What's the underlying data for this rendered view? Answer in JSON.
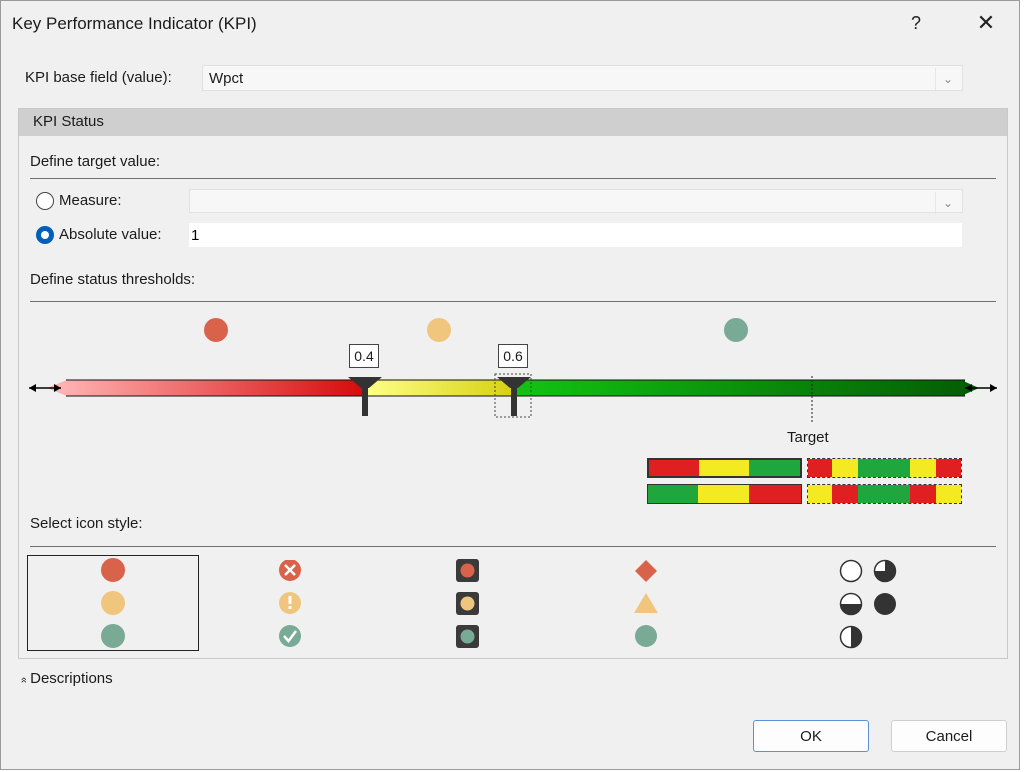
{
  "window": {
    "title": "Key Performance Indicator (KPI)",
    "help": "?",
    "close": "✕"
  },
  "base_field": {
    "label": "KPI base field (value):",
    "value": "Wpct"
  },
  "kpi_status": {
    "header": "KPI Status",
    "target_section": "Define target value:",
    "measure_label": "Measure:",
    "measure_value": "",
    "absolute_label": "Absolute value:",
    "absolute_value": "1",
    "selected_target_mode": "absolute"
  },
  "thresholds": {
    "section": "Define status thresholds:",
    "values": [
      "0.4",
      "0.6"
    ],
    "target_label": "Target",
    "status_colors": [
      "#d9634a",
      "#f0c67e",
      "#78aa96"
    ]
  },
  "icon_style": {
    "section": "Select icon style:",
    "selected_index": 0
  },
  "descriptions": {
    "toggle": "»",
    "label": "Descriptions"
  },
  "buttons": {
    "ok": "OK",
    "cancel": "Cancel"
  },
  "colors": {
    "red": "#e02020",
    "yellow": "#f4ea22",
    "green": "#1fa63c",
    "accent": "#005fb8"
  }
}
